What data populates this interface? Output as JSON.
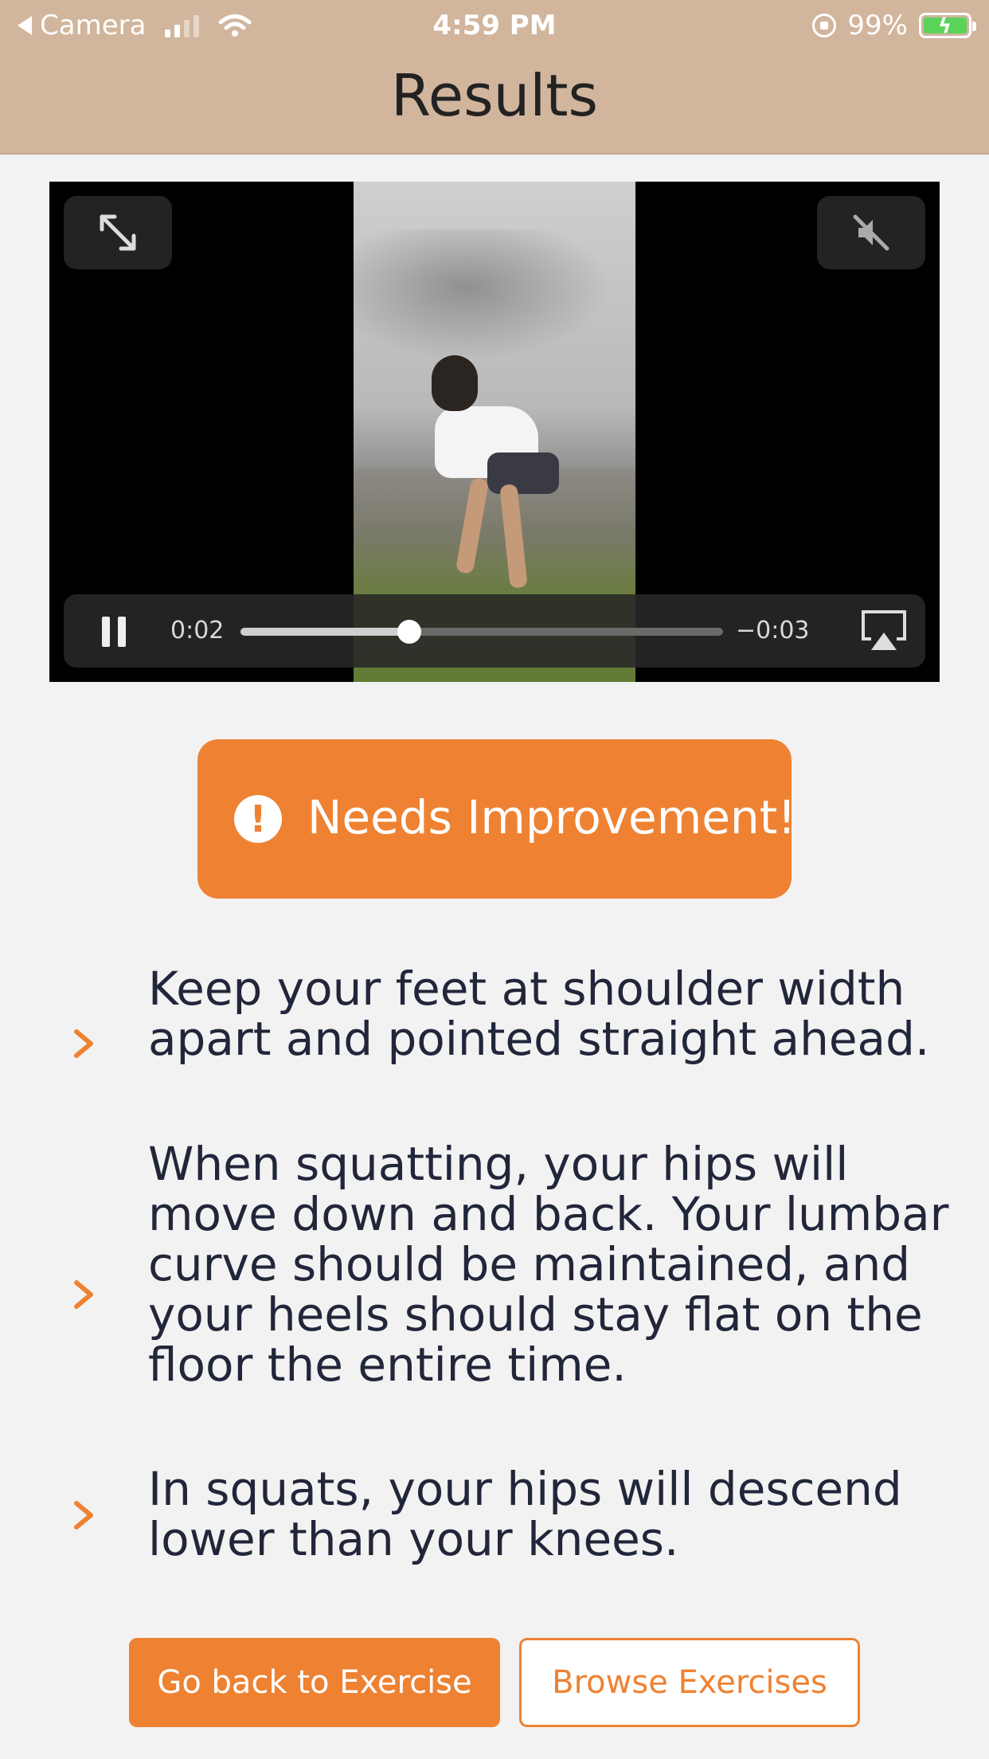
{
  "status_bar": {
    "back_app": "Camera",
    "time": "4:59 PM",
    "battery": "99%"
  },
  "header": {
    "title": "Results"
  },
  "video": {
    "current_time": "0:02",
    "remaining_time": "−0:03",
    "progress": 0.35,
    "icons": [
      "expand-icon",
      "mute-icon",
      "pause-icon",
      "airplay-icon"
    ]
  },
  "result": {
    "label": "Needs Improvement!",
    "icon": "exclamation-circle-icon",
    "color": "#ee8232"
  },
  "tips": [
    {
      "text": "Keep your feet at shoulder width apart and pointed straight ahead."
    },
    {
      "text": "When squatting, your hips will move down and back. Your lumbar curve should be maintained, and your heels should stay flat on the floor the entire time."
    },
    {
      "text": "In squats, your hips will descend lower than your knees."
    }
  ],
  "actions": {
    "primary_label": "Go back to Exercise",
    "secondary_label": "Browse Exercises"
  },
  "colors": {
    "accent": "#ee8232",
    "header_bg": "#d1b59c"
  }
}
